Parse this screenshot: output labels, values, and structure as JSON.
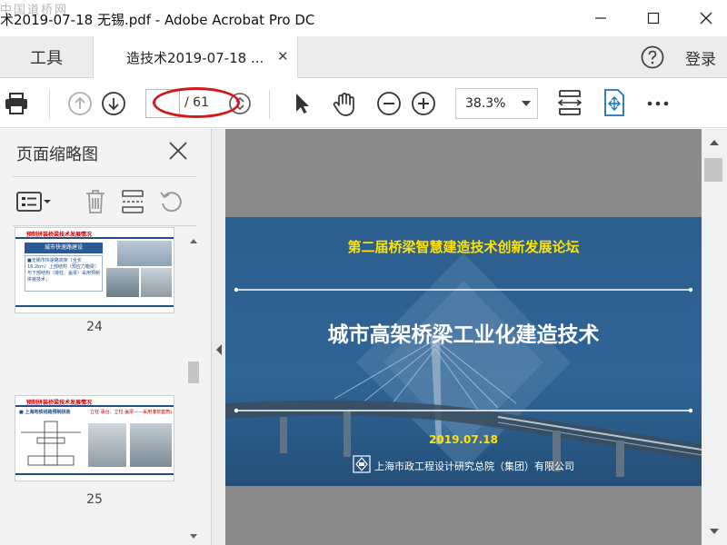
{
  "window": {
    "title": "术2019-07-18 无锡.pdf - Adobe Acrobat Pro DC",
    "watermark": "中国道桥网"
  },
  "tabs": {
    "tools_label": "工具",
    "doc_tab_label": "造技术2019-07-18 ...",
    "close_glyph": "✕",
    "login_label": "登录"
  },
  "toolbar": {
    "current_page": "",
    "page_total": "/ 61",
    "zoom": "38.3%"
  },
  "thumbnails": {
    "panel_title": "页面缩略图",
    "items": [
      {
        "page": "24",
        "heading": "预制拼装桥梁技术发展情况",
        "boxtitle": "城市快速路建设",
        "text": "■无锡市快速路高架（全长16.2km）上部结构（预应力箱梁）与下部结构（墩柱、盖梁）采用预制拼装技术；"
      },
      {
        "page": "25",
        "heading": "预制拼装桥梁技术发展情况",
        "boxtitle": "■ 上海地铁线路预制拼装",
        "text": "立柱·承台、立柱·盖梁——采用灌浆套筒连接"
      }
    ]
  },
  "document": {
    "subtitle": "第二届桥梁智慧建造技术创新发展论坛",
    "title": "城市高架桥梁工业化建造技术",
    "date": "2019.07.18",
    "organization": "上海市政工程设计研究总院（集团）有限公司"
  },
  "colors": {
    "annotation_red": "#d01a1a",
    "slide_blue": "#2b5b86",
    "highlight_yellow": "#ffe100"
  }
}
